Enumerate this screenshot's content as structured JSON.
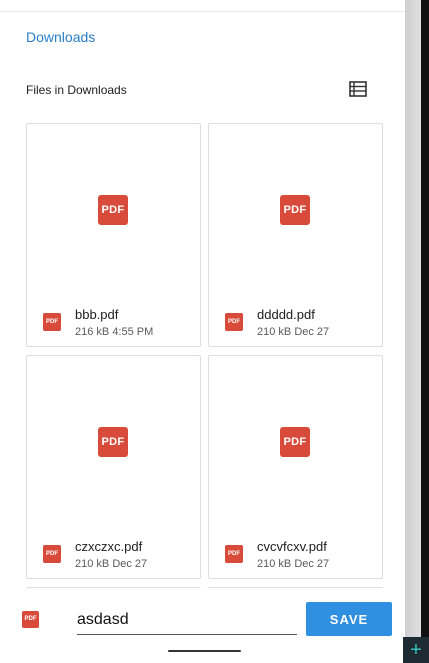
{
  "breadcrumb": {
    "label": "Downloads"
  },
  "section": {
    "title": "Files in Downloads",
    "view_toggle_icon": "list-view-icon"
  },
  "icon_text": "PDF",
  "files": [
    {
      "name": "bbb.pdf",
      "size": "216 kB",
      "date": "4:55 PM"
    },
    {
      "name": "ddddd.pdf",
      "size": "210 kB",
      "date": "Dec 27"
    },
    {
      "name": "czxczxc.pdf",
      "size": "210 kB",
      "date": "Dec 27"
    },
    {
      "name": "cvcvfcxv.pdf",
      "size": "210 kB",
      "date": "Dec 27"
    }
  ],
  "save_bar": {
    "filename_value": "asdasd",
    "save_label": "SAVE"
  },
  "colors": {
    "accent": "#2f8fe0",
    "pdf": "#d84a3a",
    "link": "#2a7ec8"
  },
  "overlay": {
    "fab_symbol": "+"
  }
}
